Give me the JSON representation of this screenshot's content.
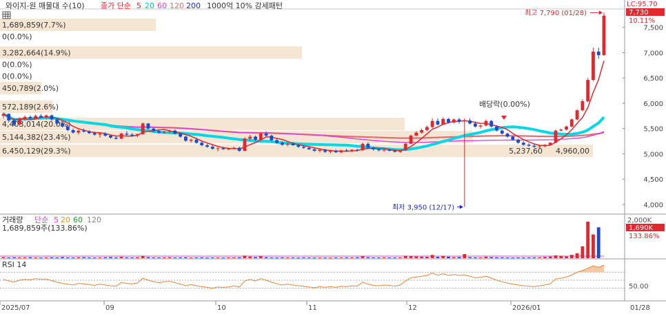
{
  "header": {
    "icon": "grid-icon",
    "title": "와이지-원 매물대 수(10)",
    "ma_prefix": "종가 단순",
    "ma_items": [
      {
        "label": "5",
        "color": "#e0282e"
      },
      {
        "label": "20",
        "color": "#00c8d8"
      },
      {
        "label": "60",
        "color": "#e040e0"
      },
      {
        "label": "120",
        "color": "#e07070"
      },
      {
        "label": "200",
        "color": "#1a2ad0"
      }
    ],
    "pattern": "1000억 10% 강세패턴"
  },
  "price_panel": {
    "lc_label": "LC:95.70",
    "last_price": "7,730",
    "last_change": "10.11%",
    "high_annotation": "최고 7,790 (01/28)",
    "low_annotation": "최저 3,950 (12/17)",
    "dividend_annotation": "배당락(0.00%)",
    "volume_profile": [
      {
        "label": "1,689,859(7.7%)",
        "price": 7550,
        "width": 226
      },
      {
        "label": "0(0.0%)",
        "price": 7320,
        "width": 0
      },
      {
        "label": "3,282,664(14.9%)",
        "price": 7000,
        "width": 438
      },
      {
        "label": "0(0.0%)",
        "price": 6770,
        "width": 0
      },
      {
        "label": "0(0.0%)",
        "price": 6540,
        "width": 0
      },
      {
        "label": "450,789(2.0%)",
        "price": 6300,
        "width": 60
      },
      {
        "label": "572,189(2.6%)",
        "price": 5930,
        "width": 76
      },
      {
        "label": "4,403,014(20.0%)",
        "price": 5590,
        "width": 587
      },
      {
        "label": "5,144,382(23.4%)",
        "price": 5330,
        "width": 686
      },
      {
        "label": "6,450,129(29.3%)",
        "price": 5060,
        "width": 860
      }
    ],
    "extra_profile_labels": [
      "5,237,60",
      "4,960,00"
    ],
    "y_ticks": [
      {
        "label": "7,500",
        "value": 7500
      },
      {
        "label": "7,000",
        "value": 7000
      },
      {
        "label": "6,500",
        "value": 6500
      },
      {
        "label": "6,000",
        "value": 6000
      },
      {
        "label": "5,500",
        "value": 5500
      },
      {
        "label": "5,000",
        "value": 5000
      },
      {
        "label": "4,500",
        "value": 4500
      },
      {
        "label": "4,000",
        "value": 4000
      }
    ]
  },
  "volume_panel": {
    "legend_title": "거래량",
    "legend_prefix": "단순",
    "legend_items": [
      {
        "label": "5",
        "color": "#e040e0"
      },
      {
        "label": "20",
        "color": "#e0a020"
      },
      {
        "label": "60",
        "color": "#20a020"
      },
      {
        "label": "120",
        "color": "#888888"
      }
    ],
    "info": "1,689,859주(133.86%)",
    "last_volume": "1,690K",
    "last_pct": "133.86%",
    "y_tick": "2,000K"
  },
  "rsi_panel": {
    "legend": "RSI 14",
    "tick": "50.00"
  },
  "x_axis": {
    "labels": [
      "2025/07",
      "09",
      "10",
      "11",
      "12",
      "2026/01",
      "01/28"
    ]
  },
  "chart_data": {
    "type": "candlestick",
    "ylim": [
      3850,
      7850
    ],
    "volume_ylim": [
      0,
      2000
    ],
    "rsi_ylim": [
      0,
      100
    ],
    "candles": [
      [
        5750,
        5820,
        5700,
        5790
      ],
      [
        5790,
        5800,
        5620,
        5660
      ],
      [
        5660,
        5700,
        5550,
        5580
      ],
      [
        5580,
        5720,
        5560,
        5700
      ],
      [
        5700,
        5760,
        5650,
        5730
      ],
      [
        5730,
        5760,
        5680,
        5700
      ],
      [
        5700,
        5780,
        5690,
        5750
      ],
      [
        5750,
        5790,
        5700,
        5720
      ],
      [
        5720,
        5780,
        5680,
        5760
      ],
      [
        5760,
        5780,
        5650,
        5680
      ],
      [
        5680,
        5700,
        5580,
        5600
      ],
      [
        5600,
        5620,
        5520,
        5540
      ],
      [
        5540,
        5580,
        5450,
        5470
      ],
      [
        5470,
        5500,
        5400,
        5420
      ],
      [
        5420,
        5480,
        5380,
        5460
      ],
      [
        5460,
        5500,
        5420,
        5440
      ],
      [
        5440,
        5470,
        5390,
        5410
      ],
      [
        5410,
        5440,
        5360,
        5380
      ],
      [
        5380,
        5420,
        5320,
        5400
      ],
      [
        5400,
        5430,
        5340,
        5360
      ],
      [
        5360,
        5380,
        5300,
        5320
      ],
      [
        5320,
        5350,
        5280,
        5300
      ],
      [
        5300,
        5420,
        5290,
        5400
      ],
      [
        5400,
        5450,
        5360,
        5380
      ],
      [
        5380,
        5410,
        5340,
        5360
      ],
      [
        5360,
        5400,
        5330,
        5390
      ],
      [
        5390,
        5620,
        5380,
        5600
      ],
      [
        5600,
        5610,
        5480,
        5500
      ],
      [
        5500,
        5520,
        5420,
        5450
      ],
      [
        5450,
        5480,
        5400,
        5420
      ],
      [
        5420,
        5460,
        5400,
        5440
      ],
      [
        5440,
        5480,
        5410,
        5460
      ],
      [
        5460,
        5480,
        5380,
        5400
      ],
      [
        5400,
        5420,
        5320,
        5340
      ],
      [
        5340,
        5360,
        5240,
        5260
      ],
      [
        5260,
        5300,
        5220,
        5280
      ],
      [
        5280,
        5320,
        5200,
        5220
      ],
      [
        5220,
        5250,
        5150,
        5170
      ],
      [
        5170,
        5200,
        5120,
        5140
      ],
      [
        5140,
        5170,
        5080,
        5100
      ],
      [
        5100,
        5130,
        5050,
        5110
      ],
      [
        5110,
        5140,
        5080,
        5090
      ],
      [
        5090,
        5120,
        5070,
        5100
      ],
      [
        5100,
        5140,
        5080,
        5120
      ],
      [
        5120,
        5140,
        5040,
        5060
      ],
      [
        5060,
        5330,
        5050,
        5300
      ],
      [
        5300,
        5380,
        5260,
        5340
      ],
      [
        5340,
        5360,
        5250,
        5280
      ],
      [
        5280,
        5430,
        5270,
        5400
      ],
      [
        5400,
        5440,
        5340,
        5360
      ],
      [
        5360,
        5380,
        5250,
        5270
      ],
      [
        5270,
        5300,
        5200,
        5220
      ],
      [
        5220,
        5250,
        5160,
        5180
      ],
      [
        5180,
        5220,
        5150,
        5200
      ],
      [
        5200,
        5230,
        5160,
        5170
      ],
      [
        5170,
        5190,
        5120,
        5140
      ],
      [
        5140,
        5170,
        5100,
        5120
      ],
      [
        5120,
        5140,
        5080,
        5090
      ],
      [
        5090,
        5110,
        5040,
        5060
      ],
      [
        5060,
        5100,
        5030,
        5080
      ],
      [
        5080,
        5100,
        5020,
        5040
      ],
      [
        5040,
        5080,
        5010,
        5060
      ],
      [
        5060,
        5090,
        5020,
        5030
      ],
      [
        5030,
        5080,
        5010,
        5070
      ],
      [
        5070,
        5100,
        5040,
        5060
      ],
      [
        5060,
        5090,
        5030,
        5080
      ],
      [
        5080,
        5100,
        5050,
        5070
      ],
      [
        5070,
        5220,
        5060,
        5200
      ],
      [
        5200,
        5230,
        5100,
        5120
      ],
      [
        5120,
        5140,
        5060,
        5090
      ],
      [
        5090,
        5110,
        5050,
        5070
      ],
      [
        5070,
        5100,
        5040,
        5080
      ],
      [
        5080,
        5100,
        5050,
        5060
      ],
      [
        5060,
        5090,
        5030,
        5040
      ],
      [
        5040,
        5080,
        5020,
        5070
      ],
      [
        5070,
        5220,
        5060,
        5200
      ],
      [
        5200,
        5380,
        5190,
        5360
      ],
      [
        5360,
        5450,
        5340,
        5420
      ],
      [
        5420,
        5500,
        5400,
        5470
      ],
      [
        5470,
        5560,
        5450,
        5530
      ],
      [
        5530,
        5700,
        5500,
        5650
      ],
      [
        5650,
        5700,
        5560,
        5580
      ],
      [
        5580,
        5720,
        5570,
        5690
      ],
      [
        5690,
        5710,
        5600,
        5620
      ],
      [
        5620,
        5700,
        5600,
        5680
      ],
      [
        5680,
        5710,
        5600,
        5640
      ],
      [
        5640,
        5700,
        3950,
        5660
      ],
      [
        5660,
        5700,
        5580,
        5600
      ],
      [
        5600,
        5640,
        5520,
        5540
      ],
      [
        5540,
        5580,
        5500,
        5560
      ],
      [
        5560,
        5680,
        5540,
        5650
      ],
      [
        5650,
        5670,
        5520,
        5540
      ],
      [
        5540,
        5560,
        5440,
        5460
      ],
      [
        5460,
        5480,
        5380,
        5400
      ],
      [
        5400,
        5420,
        5320,
        5340
      ],
      [
        5340,
        5360,
        5260,
        5280
      ],
      [
        5280,
        5300,
        5200,
        5220
      ],
      [
        5220,
        5250,
        5160,
        5180
      ],
      [
        5180,
        5210,
        5140,
        5160
      ],
      [
        5160,
        5190,
        5120,
        5140
      ],
      [
        5140,
        5170,
        5110,
        5150
      ],
      [
        5150,
        5190,
        5130,
        5180
      ],
      [
        5180,
        5230,
        5170,
        5220
      ],
      [
        5220,
        5480,
        5210,
        5460
      ],
      [
        5460,
        5500,
        5440,
        5480
      ],
      [
        5480,
        5560,
        5460,
        5540
      ],
      [
        5540,
        5700,
        5520,
        5680
      ],
      [
        5680,
        5880,
        5660,
        5860
      ],
      [
        5860,
        6080,
        5840,
        6040
      ],
      [
        6040,
        6500,
        6020,
        6460
      ],
      [
        6460,
        7100,
        6440,
        7020
      ],
      [
        7020,
        7100,
        6880,
        6950
      ],
      [
        6950,
        7790,
        6940,
        7730
      ]
    ],
    "volume": [
      60,
      40,
      50,
      45,
      50,
      55,
      40,
      35,
      45,
      50,
      40,
      60,
      40,
      35,
      50,
      55,
      40,
      35,
      45,
      50,
      60,
      40,
      75,
      45,
      40,
      50,
      120,
      60,
      45,
      40,
      50,
      55,
      40,
      45,
      50,
      35,
      40,
      45,
      30,
      40,
      35,
      30,
      40,
      45,
      50,
      140,
      85,
      60,
      95,
      55,
      40,
      35,
      45,
      40,
      35,
      30,
      40,
      35,
      30,
      40,
      35,
      30,
      40,
      35,
      45,
      40,
      50,
      95,
      55,
      40,
      35,
      45,
      40,
      35,
      40,
      125,
      110,
      90,
      80,
      75,
      175,
      70,
      120,
      80,
      60,
      65,
      225,
      55,
      45,
      40,
      80,
      60,
      50,
      45,
      40,
      35,
      40,
      35,
      40,
      45,
      50,
      70,
      85,
      150,
      130,
      90,
      180,
      270,
      650,
      2000,
      1300,
      1690
    ],
    "rsi": [
      52,
      48,
      45,
      50,
      52,
      51,
      54,
      52,
      53,
      49,
      45,
      42,
      40,
      38,
      42,
      41,
      39,
      37,
      40,
      38,
      36,
      35,
      44,
      42,
      41,
      43,
      55,
      50,
      46,
      44,
      46,
      47,
      44,
      40,
      36,
      39,
      36,
      34,
      32,
      30,
      33,
      32,
      33,
      36,
      33,
      48,
      52,
      48,
      54,
      50,
      45,
      41,
      38,
      40,
      38,
      36,
      35,
      33,
      31,
      34,
      32,
      34,
      32,
      35,
      34,
      36,
      35,
      45,
      40,
      37,
      36,
      38,
      37,
      35,
      38,
      48,
      56,
      58,
      60,
      62,
      68,
      62,
      66,
      62,
      64,
      62,
      63,
      60,
      56,
      57,
      60,
      55,
      50,
      46,
      43,
      40,
      38,
      36,
      35,
      34,
      36,
      38,
      41,
      53,
      55,
      58,
      63,
      70,
      74,
      80,
      86,
      82,
      88
    ]
  }
}
